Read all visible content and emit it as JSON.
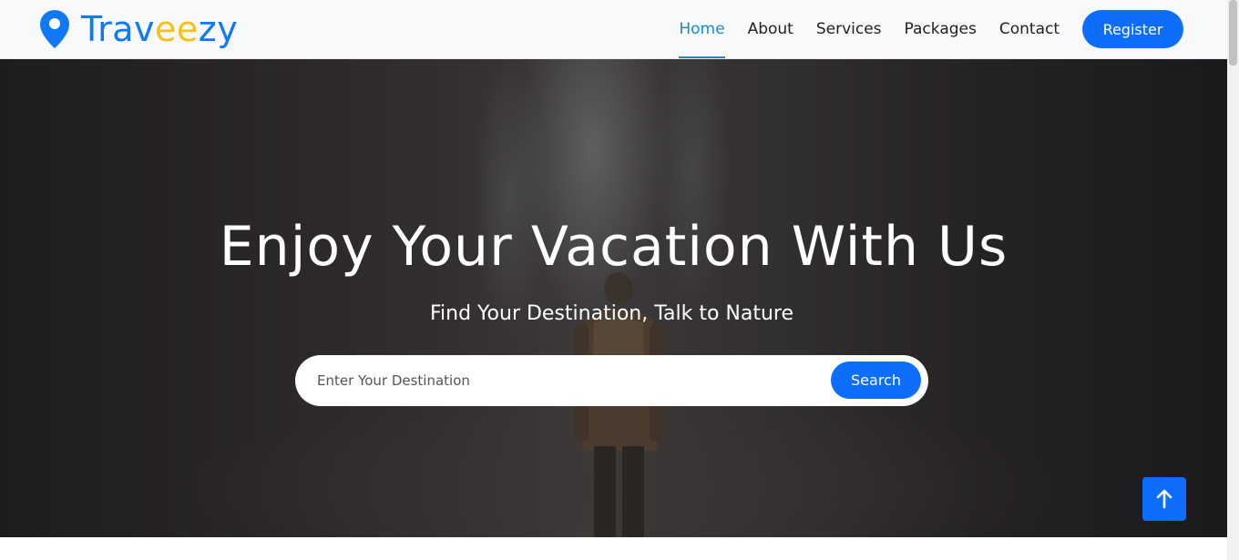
{
  "brand": {
    "name_part1": "Trav",
    "name_part2": "ee",
    "name_part3": "zy",
    "icon": "map-pin-icon",
    "colors": {
      "primary": "#1279f6",
      "accent": "#f5c018"
    }
  },
  "nav": {
    "items": [
      {
        "label": "Home",
        "active": true
      },
      {
        "label": "About",
        "active": false
      },
      {
        "label": "Services",
        "active": false
      },
      {
        "label": "Packages",
        "active": false
      },
      {
        "label": "Contact",
        "active": false
      }
    ],
    "register_label": "Register"
  },
  "hero": {
    "title": "Enjoy Your Vacation With Us",
    "subtitle": "Find Your Destination, Talk to Nature",
    "search": {
      "placeholder": "Enter Your Destination",
      "value": "",
      "button_label": "Search"
    }
  },
  "back_to_top": {
    "icon": "arrow-up-icon"
  },
  "colors": {
    "button": "#0d6efd",
    "active_nav": "#1b8bc9"
  }
}
